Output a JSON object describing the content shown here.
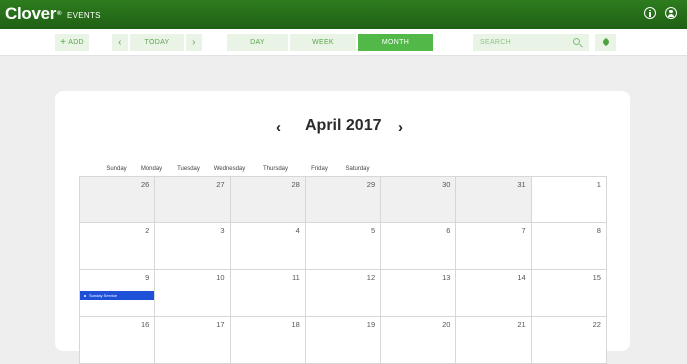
{
  "header": {
    "logo": "Clover",
    "logo_mark": "®",
    "app_name": "EVENTS",
    "icons": [
      "info-icon",
      "user-icon"
    ]
  },
  "toolbar": {
    "add_plus": "+",
    "add_label": "ADD",
    "prev": "‹",
    "today": "TODAY",
    "next": "›",
    "views": {
      "day": "DAY",
      "week": "WEEK",
      "month": "MONTH"
    },
    "active_view": "MONTH",
    "search_placeholder": "SEARCH",
    "accent_color": "#52b848"
  },
  "calendar": {
    "title": "April 2017",
    "nav_prev": "‹",
    "nav_next": "›",
    "weekdays": [
      "Sunday",
      "Monday",
      "Tuesday",
      "Wednesday",
      "Thursday",
      "Friday",
      "Saturday"
    ],
    "weeks": [
      [
        {
          "d": "26",
          "other": true
        },
        {
          "d": "27",
          "other": true
        },
        {
          "d": "28",
          "other": true
        },
        {
          "d": "29",
          "other": true
        },
        {
          "d": "30",
          "other": true
        },
        {
          "d": "31",
          "other": true
        },
        {
          "d": "1"
        }
      ],
      [
        {
          "d": "2"
        },
        {
          "d": "3"
        },
        {
          "d": "4"
        },
        {
          "d": "5"
        },
        {
          "d": "6"
        },
        {
          "d": "7"
        },
        {
          "d": "8"
        }
      ],
      [
        {
          "d": "9",
          "event": "Sunday Service"
        },
        {
          "d": "10"
        },
        {
          "d": "11"
        },
        {
          "d": "12"
        },
        {
          "d": "13"
        },
        {
          "d": "14"
        },
        {
          "d": "15"
        }
      ],
      [
        {
          "d": "16"
        },
        {
          "d": "17"
        },
        {
          "d": "18"
        },
        {
          "d": "19"
        },
        {
          "d": "20"
        },
        {
          "d": "21"
        },
        {
          "d": "22"
        }
      ]
    ],
    "event_color": "#1e50d8"
  }
}
